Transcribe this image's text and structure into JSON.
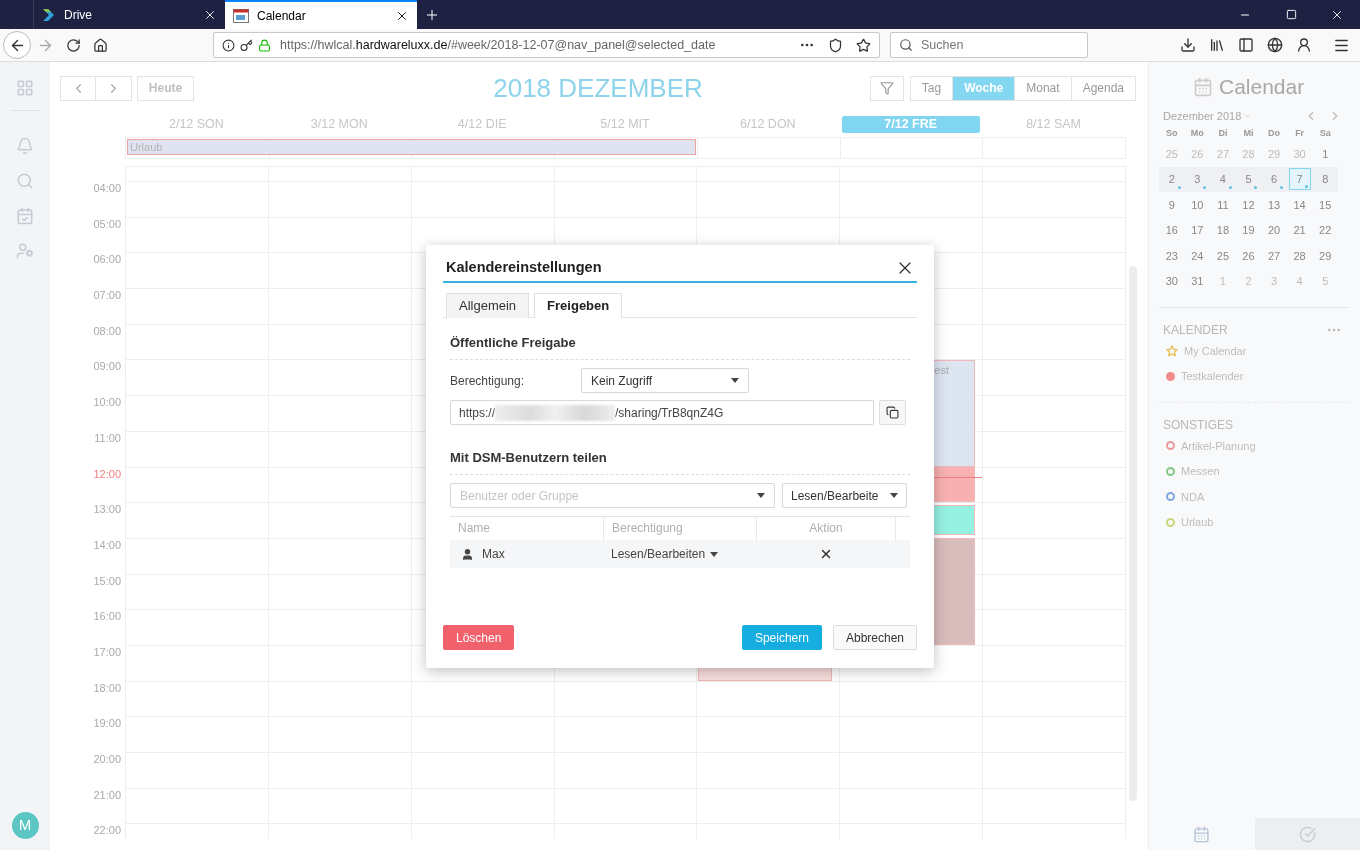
{
  "browser": {
    "tabs": [
      {
        "title": "Drive",
        "selected": false
      },
      {
        "title": "Calendar",
        "selected": true
      }
    ],
    "url": {
      "start": "https://hwlcal.",
      "domain": "hardwareluxx.de",
      "end": "/#week/2018-12-07@nav_panel@selected_date"
    },
    "search": {
      "placeholder": "Suchen"
    }
  },
  "header": {
    "today_button": "Heute",
    "title": "2018 DEZEMBER",
    "views": [
      {
        "label": "Tag",
        "selected": false
      },
      {
        "label": "Woche",
        "selected": true
      },
      {
        "label": "Monat",
        "selected": false
      },
      {
        "label": "Agenda",
        "selected": false
      }
    ]
  },
  "week": {
    "all_day_event": {
      "title": "Urlaub"
    },
    "days": [
      {
        "label": "2/12 SON",
        "selected": false
      },
      {
        "label": "3/12 MON",
        "selected": false
      },
      {
        "label": "4/12 DIE",
        "selected": false
      },
      {
        "label": "5/12 MIT",
        "selected": false
      },
      {
        "label": "6/12 DON",
        "selected": false,
        "events": [
          {
            "color": "#f9dddd"
          }
        ]
      },
      {
        "label": "7/12 FRE",
        "selected": true,
        "events": [
          {
            "title": "est",
            "color": "#dde5f1"
          },
          {
            "color": "#f8b0b0"
          },
          {
            "color": "#95f0e2"
          },
          {
            "color": "#d9bcbc"
          }
        ]
      },
      {
        "label": "8/12 SAM",
        "selected": false
      }
    ],
    "hours": [
      {
        "label": "04:00",
        "current": false
      },
      {
        "label": "05:00",
        "current": false
      },
      {
        "label": "06:00",
        "current": false
      },
      {
        "label": "07:00",
        "current": false
      },
      {
        "label": "08:00",
        "current": false
      },
      {
        "label": "09:00",
        "current": false
      },
      {
        "label": "10:00",
        "current": false
      },
      {
        "label": "11:00",
        "current": false
      },
      {
        "label": "12:00",
        "current": true
      },
      {
        "label": "13:00",
        "current": false
      },
      {
        "label": "14:00",
        "current": false
      },
      {
        "label": "15:00",
        "current": false
      },
      {
        "label": "16:00",
        "current": false
      },
      {
        "label": "17:00",
        "current": false
      },
      {
        "label": "18:00",
        "current": false
      },
      {
        "label": "19:00",
        "current": false
      },
      {
        "label": "20:00",
        "current": false
      },
      {
        "label": "21:00",
        "current": false
      },
      {
        "label": "22:00",
        "current": false
      }
    ]
  },
  "user": {
    "initial": "M"
  },
  "sidebar": {
    "title": "Calendar",
    "mini_calendar": {
      "title": "Dezember 2018",
      "weekdays": [
        "So",
        "Mo",
        "Di",
        "Mi",
        "Do",
        "Fr",
        "Sa"
      ],
      "weeks": [
        {
          "selected": false,
          "days": [
            {
              "label": "25",
              "muted": true,
              "dot": false,
              "selected": false
            },
            {
              "label": "26",
              "muted": true,
              "dot": false,
              "selected": false
            },
            {
              "label": "27",
              "muted": true,
              "dot": false,
              "selected": false
            },
            {
              "label": "28",
              "muted": true,
              "dot": false,
              "selected": false
            },
            {
              "label": "29",
              "muted": true,
              "dot": false,
              "selected": false
            },
            {
              "label": "30",
              "muted": true,
              "dot": false,
              "selected": false
            },
            {
              "label": "1",
              "muted": false,
              "dot": false,
              "selected": false
            }
          ]
        },
        {
          "selected": true,
          "days": [
            {
              "label": "2",
              "muted": false,
              "dot": true,
              "selected": false
            },
            {
              "label": "3",
              "muted": false,
              "dot": true,
              "selected": false
            },
            {
              "label": "4",
              "muted": false,
              "dot": true,
              "selected": false
            },
            {
              "label": "5",
              "muted": false,
              "dot": true,
              "selected": false
            },
            {
              "label": "6",
              "muted": false,
              "dot": true,
              "selected": false
            },
            {
              "label": "7",
              "muted": false,
              "dot": true,
              "selected": true
            },
            {
              "label": "8",
              "muted": false,
              "dot": false,
              "selected": false
            }
          ]
        },
        {
          "selected": false,
          "days": [
            {
              "label": "9",
              "muted": false,
              "dot": false,
              "selected": false
            },
            {
              "label": "10",
              "muted": false,
              "dot": false,
              "selected": false
            },
            {
              "label": "11",
              "muted": false,
              "dot": false,
              "selected": false
            },
            {
              "label": "12",
              "muted": false,
              "dot": false,
              "selected": false
            },
            {
              "label": "13",
              "muted": false,
              "dot": false,
              "selected": false
            },
            {
              "label": "14",
              "muted": false,
              "dot": false,
              "selected": false
            },
            {
              "label": "15",
              "muted": false,
              "dot": false,
              "selected": false
            }
          ]
        },
        {
          "selected": false,
          "days": [
            {
              "label": "16",
              "muted": false,
              "dot": false,
              "selected": false
            },
            {
              "label": "17",
              "muted": false,
              "dot": false,
              "selected": false
            },
            {
              "label": "18",
              "muted": false,
              "dot": false,
              "selected": false
            },
            {
              "label": "19",
              "muted": false,
              "dot": false,
              "selected": false
            },
            {
              "label": "20",
              "muted": false,
              "dot": false,
              "selected": false
            },
            {
              "label": "21",
              "muted": false,
              "dot": false,
              "selected": false
            },
            {
              "label": "22",
              "muted": false,
              "dot": false,
              "selected": false
            }
          ]
        },
        {
          "selected": false,
          "days": [
            {
              "label": "23",
              "muted": false,
              "dot": false,
              "selected": false
            },
            {
              "label": "24",
              "muted": false,
              "dot": false,
              "selected": false
            },
            {
              "label": "25",
              "muted": false,
              "dot": false,
              "selected": false
            },
            {
              "label": "26",
              "muted": false,
              "dot": false,
              "selected": false
            },
            {
              "label": "27",
              "muted": false,
              "dot": false,
              "selected": false
            },
            {
              "label": "28",
              "muted": false,
              "dot": false,
              "selected": false
            },
            {
              "label": "29",
              "muted": false,
              "dot": false,
              "selected": false
            }
          ]
        },
        {
          "selected": false,
          "days": [
            {
              "label": "30",
              "muted": false,
              "dot": false,
              "selected": false
            },
            {
              "label": "31",
              "muted": false,
              "dot": false,
              "selected": false
            },
            {
              "label": "1",
              "muted": true,
              "dot": false,
              "selected": false
            },
            {
              "label": "2",
              "muted": true,
              "dot": false,
              "selected": false
            },
            {
              "label": "3",
              "muted": true,
              "dot": false,
              "selected": false
            },
            {
              "label": "4",
              "muted": true,
              "dot": false,
              "selected": false
            },
            {
              "label": "5",
              "muted": true,
              "dot": false,
              "selected": false
            }
          ]
        }
      ]
    },
    "sections": [
      {
        "title": "KALENDER",
        "items": [
          {
            "label": "My Calendar",
            "kind": "star",
            "color": "#e6c35c"
          },
          {
            "label": "Testkalender",
            "kind": "dot",
            "color": "#f28b8b"
          }
        ]
      },
      {
        "title": "SONSTIGES",
        "items": [
          {
            "label": "Artikel-Planung",
            "kind": "ring",
            "color": "#e89a9a"
          },
          {
            "label": "Messen",
            "kind": "ring",
            "color": "#84c984"
          },
          {
            "label": "NDA",
            "kind": "ring",
            "color": "#7ea6de"
          },
          {
            "label": "Urlaub",
            "kind": "ring",
            "color": "#c6d77a"
          }
        ]
      }
    ]
  },
  "dialog": {
    "title": "Kalendereinstellungen",
    "tabs": [
      {
        "label": "Allgemein",
        "selected": false
      },
      {
        "label": "Freigeben",
        "selected": true
      }
    ],
    "public_sharing": {
      "heading": "Öffentliche Freigabe",
      "permission_label": "Berechtigung:",
      "permission_value": "Kein Zugriff",
      "link_start": "https://",
      "link_end": "/sharing/TrB8qnZ4G"
    },
    "user_sharing": {
      "heading": "Mit DSM-Benutzern teilen",
      "user_placeholder": "Benutzer oder Gruppe",
      "permission_value": "Lesen/Bearbeite",
      "columns": [
        "Name",
        "Berechtigung",
        "Aktion"
      ],
      "rows": [
        {
          "name": "Max",
          "permission": "Lesen/Bearbeiten"
        }
      ]
    },
    "buttons": {
      "delete": "Löschen",
      "save": "Speichern",
      "cancel": "Abbrechen"
    }
  }
}
